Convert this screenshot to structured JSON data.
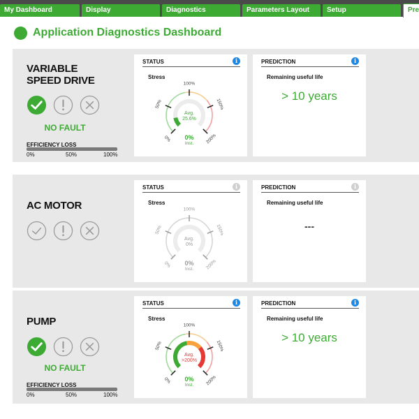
{
  "tabs": [
    {
      "label": "My Dashboard"
    },
    {
      "label": "Display"
    },
    {
      "label": "Diagnostics"
    },
    {
      "label": "Parameters Layout"
    },
    {
      "label": "Setup"
    },
    {
      "label": "Pred"
    }
  ],
  "active_tab": 5,
  "page": {
    "title": "Application Diagnostics Dashboard"
  },
  "colors": {
    "accent": "#3daa34",
    "info": "#1e88e5",
    "fault": "#e53935",
    "warn": "#f7a23a",
    "inactive": "#cfcfcf"
  },
  "devices": [
    {
      "name_line1": "VARIABLE",
      "name_line2": "SPEED DRIVE",
      "state": "ok",
      "fault_label": "NO FAULT",
      "efficiency_loss": {
        "label": "EFFICIENCY LOSS",
        "ticks": [
          "0%",
          "50%",
          "100%"
        ],
        "value": 0
      },
      "status": {
        "title": "STATUS",
        "info_icon": "info-icon",
        "stress_label": "Stress",
        "gauge": {
          "scale_labels": [
            "0%",
            "50%",
            "100%",
            "150%",
            "200%"
          ],
          "avg_label": "Avg.",
          "avg_value": "25.6%",
          "inst_value": "0%",
          "inst_label": "Inst.",
          "level_percent": 25.6,
          "fill_color": "#3daa34"
        }
      },
      "prediction": {
        "title": "PREDICTION",
        "info_icon": "info-icon",
        "label": "Remaining useful life",
        "value": "> 10 years"
      }
    },
    {
      "name_line1": "AC MOTOR",
      "name_line2": "",
      "state": "inactive",
      "fault_label": "",
      "efficiency_loss": null,
      "status": {
        "title": "STATUS",
        "info_icon": "info-icon",
        "stress_label": "Stress",
        "gauge": {
          "scale_labels": [
            "0%",
            "50%",
            "100%",
            "150%",
            "200%"
          ],
          "avg_label": "Avg.",
          "avg_value": "0%",
          "inst_value": "0%",
          "inst_label": "Inst.",
          "level_percent": 0,
          "fill_color": "#cfcfcf"
        }
      },
      "prediction": {
        "title": "PREDICTION",
        "info_icon": "info-icon",
        "label": "Remaining useful life",
        "value": "---"
      }
    },
    {
      "name_line1": "PUMP",
      "name_line2": "",
      "state": "ok",
      "fault_label": "NO FAULT",
      "efficiency_loss": {
        "label": "EFFICIENCY LOSS",
        "ticks": [
          "0%",
          "50%",
          "100%"
        ],
        "value": 0
      },
      "status": {
        "title": "STATUS",
        "info_icon": "info-icon",
        "stress_label": "Stress",
        "gauge": {
          "scale_labels": [
            "0%",
            "50%",
            "100%",
            "150%",
            "200%"
          ],
          "avg_label": "Avg.",
          "avg_value": ">200%",
          "inst_value": "0%",
          "inst_label": "Inst.",
          "level_percent": 200,
          "fill_color": "#e53935"
        }
      },
      "prediction": {
        "title": "PREDICTION",
        "info_icon": "info-icon",
        "label": "Remaining useful life",
        "value": "> 10 years"
      }
    }
  ]
}
